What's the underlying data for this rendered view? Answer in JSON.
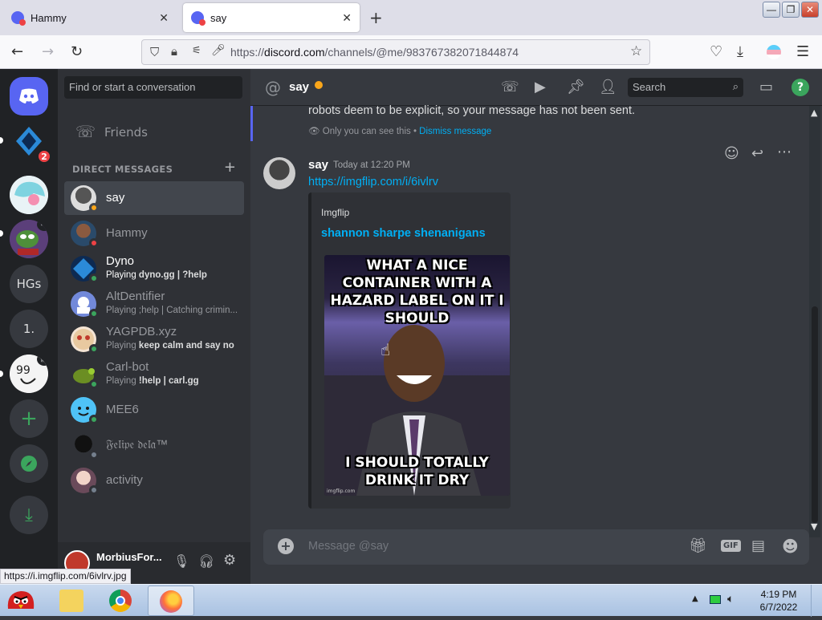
{
  "browser": {
    "tabs": [
      {
        "title": "Hammy",
        "active": false
      },
      {
        "title": "say",
        "active": true
      }
    ],
    "url_prefix": "https://",
    "url_domain": "discord.com",
    "url_path": "/channels/@me/983767382071844874",
    "status_link": "https://i.imgflip.com/6ivlrv.jpg"
  },
  "servers": [
    {
      "label": "",
      "icon": "discord-home-icon"
    },
    {
      "label": "",
      "icon": "dyno-server-icon",
      "badge": "2"
    },
    {
      "label": "",
      "icon": "anime-server-icon"
    },
    {
      "label": "",
      "icon": "frog-server-icon"
    },
    {
      "label": "HGs"
    },
    {
      "label": "1."
    },
    {
      "label": "",
      "icon": "99-server-icon"
    },
    {
      "label": "",
      "icon": "add-server-icon"
    },
    {
      "label": "",
      "icon": "explore-icon"
    },
    {
      "label": "",
      "icon": "download-icon"
    }
  ],
  "dm": {
    "search_placeholder": "Find or start a conversation",
    "friends_label": "Friends",
    "section_title": "DIRECT MESSAGES",
    "items": [
      {
        "name": "say",
        "status": "#faa61a",
        "selected": true
      },
      {
        "name": "Hammy",
        "status": "#ed4245"
      },
      {
        "name": "Dyno",
        "activity_prefix": "Playing ",
        "activity": "dyno.gg | ?help",
        "status": "#3ba55d"
      },
      {
        "name": "AltDentifier",
        "activity_prefix": "Playing ",
        "activity": ";help | Catching crimin...",
        "status": "#3ba55d"
      },
      {
        "name": "YAGPDB.xyz",
        "activity_prefix": "Playing ",
        "activity": "keep calm and say no",
        "status": "#3ba55d"
      },
      {
        "name": "Carl-bot",
        "activity_prefix": "Playing ",
        "activity": "!help | carl.gg",
        "status": "#3ba55d"
      },
      {
        "name": "MEE6",
        "status": "#3ba55d"
      },
      {
        "name": "𝔉𝔢𝔩𝔦𝔭𝔢 𝔡𝔢𝔩𝔞™",
        "status": "#747f8d"
      },
      {
        "name": "activity",
        "status": "#747f8d"
      }
    ]
  },
  "user_panel": {
    "name": "MorbiusFor..."
  },
  "channel": {
    "name": "say",
    "search_placeholder": "Search"
  },
  "messages": {
    "prev_text": "robots deem to be explicit, so your message has not been sent.",
    "prev_note": "Only you can see this",
    "prev_note_sep": " • ",
    "prev_dismiss": "Dismiss message",
    "author": "say",
    "timestamp": "Today at 12:20 PM",
    "link": "https://imgflip.com/i/6ivlrv",
    "embed_provider": "Imgflip",
    "embed_title": "shannon sharpe shenanigans",
    "meme_top": "WHAT A NICE CONTAINER WITH A HAZARD LABEL ON IT I SHOULD",
    "meme_bottom": "I SHOULD TOTALLY DRINK IT DRY",
    "meme_watermark": "imgflip.com"
  },
  "composer": {
    "placeholder": "Message @say",
    "gif_label": "GIF"
  },
  "taskbar": {
    "time": "4:19 PM",
    "date": "6/7/2022"
  }
}
